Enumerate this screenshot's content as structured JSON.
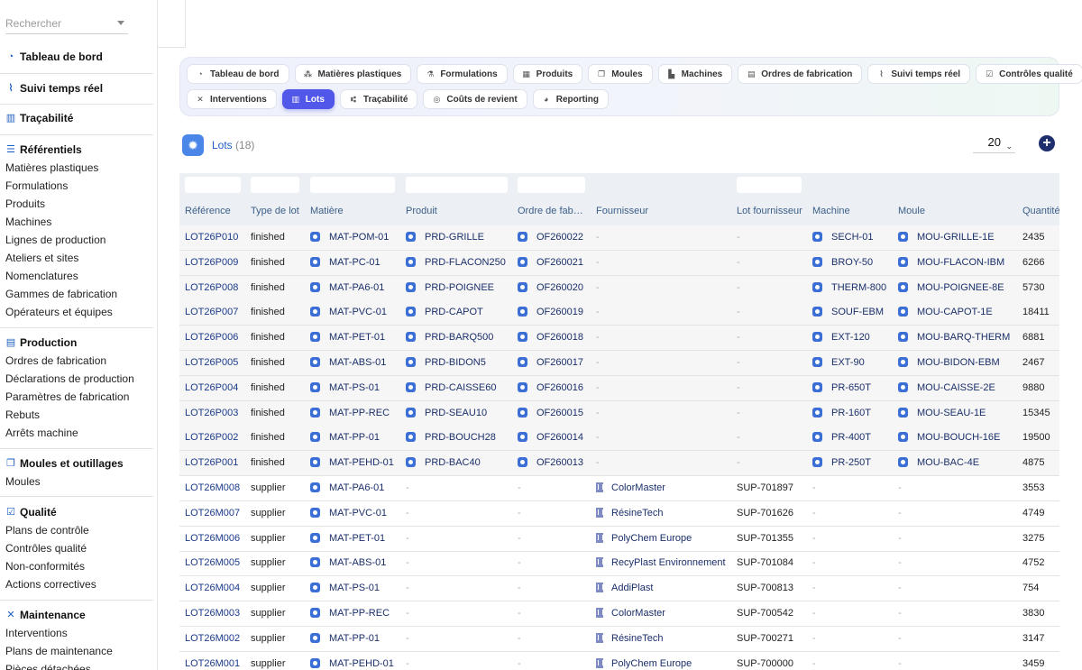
{
  "search": {
    "placeholder": "Rechercher"
  },
  "sidebar": {
    "dashboard": "Tableau de bord",
    "realtime": "Suivi temps réel",
    "traceability": "Traçabilité",
    "referentiels": {
      "title": "Référentiels",
      "items": [
        "Matières plastiques",
        "Formulations",
        "Produits",
        "Machines",
        "Lignes de production",
        "Ateliers et sites",
        "Nomenclatures",
        "Gammes de fabrication",
        "Opérateurs et équipes"
      ]
    },
    "production": {
      "title": "Production",
      "items": [
        "Ordres de fabrication",
        "Déclarations de production",
        "Paramètres de fabrication",
        "Rebuts",
        "Arrêts machine"
      ]
    },
    "moules": {
      "title": "Moules et outillages",
      "items": [
        "Moules"
      ]
    },
    "qualite": {
      "title": "Qualité",
      "items": [
        "Plans de contrôle",
        "Contrôles qualité",
        "Non-conformités",
        "Actions correctives"
      ]
    },
    "maintenance": {
      "title": "Maintenance",
      "items": [
        "Interventions",
        "Plans de maintenance",
        "Pièces détachées"
      ]
    }
  },
  "nav": {
    "row1": [
      "Tableau de bord",
      "Matières plastiques",
      "Formulations",
      "Produits",
      "Moules",
      "Machines",
      "Ordres de fabrication",
      "Suivi temps réel",
      "Contrôles qualité"
    ],
    "row2": [
      "Interventions",
      "Lots",
      "Traçabilité",
      "Coûts de revient",
      "Reporting"
    ],
    "active": "Lots"
  },
  "page": {
    "title": "Lots",
    "count": "(18)",
    "page_size": "20"
  },
  "table": {
    "columns": [
      "Référence",
      "Type de lot",
      "Matière",
      "Produit",
      "Ordre de fab…",
      "Fournisseur",
      "Lot fournisseur",
      "Machine",
      "Moule",
      "Quantité"
    ],
    "rows": [
      [
        "LOT26P010",
        "finished",
        "MAT-POM-01",
        "PRD-GRILLE",
        "OF260022",
        "-",
        "-",
        "SECH-01",
        "MOU-GRILLE-1E",
        "2435"
      ],
      [
        "LOT26P009",
        "finished",
        "MAT-PC-01",
        "PRD-FLACON250",
        "OF260021",
        "-",
        "-",
        "BROY-50",
        "MOU-FLACON-IBM",
        "6266"
      ],
      [
        "LOT26P008",
        "finished",
        "MAT-PA6-01",
        "PRD-POIGNEE",
        "OF260020",
        "-",
        "-",
        "THERM-800",
        "MOU-POIGNEE-8E",
        "5730"
      ],
      [
        "LOT26P007",
        "finished",
        "MAT-PVC-01",
        "PRD-CAPOT",
        "OF260019",
        "-",
        "-",
        "SOUF-EBM",
        "MOU-CAPOT-1E",
        "18411"
      ],
      [
        "LOT26P006",
        "finished",
        "MAT-PET-01",
        "PRD-BARQ500",
        "OF260018",
        "-",
        "-",
        "EXT-120",
        "MOU-BARQ-THERM",
        "6881"
      ],
      [
        "LOT26P005",
        "finished",
        "MAT-ABS-01",
        "PRD-BIDON5",
        "OF260017",
        "-",
        "-",
        "EXT-90",
        "MOU-BIDON-EBM",
        "2467"
      ],
      [
        "LOT26P004",
        "finished",
        "MAT-PS-01",
        "PRD-CAISSE60",
        "OF260016",
        "-",
        "-",
        "PR-650T",
        "MOU-CAISSE-2E",
        "9880"
      ],
      [
        "LOT26P003",
        "finished",
        "MAT-PP-REC",
        "PRD-SEAU10",
        "OF260015",
        "-",
        "-",
        "PR-160T",
        "MOU-SEAU-1E",
        "15345"
      ],
      [
        "LOT26P002",
        "finished",
        "MAT-PP-01",
        "PRD-BOUCH28",
        "OF260014",
        "-",
        "-",
        "PR-400T",
        "MOU-BOUCH-16E",
        "19500"
      ],
      [
        "LOT26P001",
        "finished",
        "MAT-PEHD-01",
        "PRD-BAC40",
        "OF260013",
        "-",
        "-",
        "PR-250T",
        "MOU-BAC-4E",
        "4875"
      ],
      [
        "LOT26M008",
        "supplier",
        "MAT-PA6-01",
        "-",
        "-",
        "ColorMaster",
        "SUP-701897",
        "-",
        "-",
        "3553"
      ],
      [
        "LOT26M007",
        "supplier",
        "MAT-PVC-01",
        "-",
        "-",
        "RésineTech",
        "SUP-701626",
        "-",
        "-",
        "4749"
      ],
      [
        "LOT26M006",
        "supplier",
        "MAT-PET-01",
        "-",
        "-",
        "PolyChem Europe",
        "SUP-701355",
        "-",
        "-",
        "3275"
      ],
      [
        "LOT26M005",
        "supplier",
        "MAT-ABS-01",
        "-",
        "-",
        "RecyPlast Environnement",
        "SUP-701084",
        "-",
        "-",
        "4752"
      ],
      [
        "LOT26M004",
        "supplier",
        "MAT-PS-01",
        "-",
        "-",
        "AddiPlast",
        "SUP-700813",
        "-",
        "-",
        "754"
      ],
      [
        "LOT26M003",
        "supplier",
        "MAT-PP-REC",
        "-",
        "-",
        "ColorMaster",
        "SUP-700542",
        "-",
        "-",
        "3830"
      ],
      [
        "LOT26M002",
        "supplier",
        "MAT-PP-01",
        "-",
        "-",
        "RésineTech",
        "SUP-700271",
        "-",
        "-",
        "3147"
      ],
      [
        "LOT26M001",
        "supplier",
        "MAT-PEHD-01",
        "-",
        "-",
        "PolyChem Europe",
        "SUP-700000",
        "-",
        "-",
        "3459"
      ]
    ]
  },
  "colors": {
    "accent": "#5157e8",
    "link": "#1a2f6b",
    "chip": "#3b6fd6",
    "add_button": "#1e2f6e"
  }
}
